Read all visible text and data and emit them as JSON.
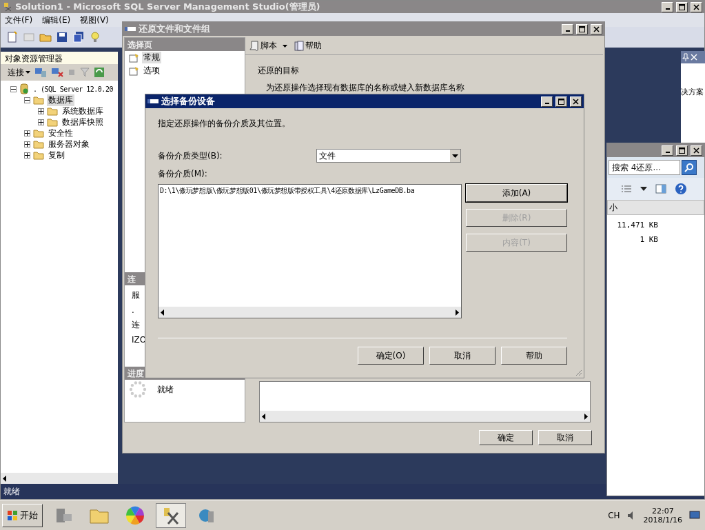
{
  "main_window": {
    "title": "Solution1 - Microsoft SQL Server Management Studio(管理员)",
    "menu": [
      "文件(F)",
      "编辑(E)",
      "视图(V)"
    ],
    "status": "就绪"
  },
  "object_explorer": {
    "title": "对象资源管理器",
    "connect": "连接",
    "tree": [
      {
        "label": ". (SQL Server 12.0.20",
        "kind": "server",
        "expanded": true,
        "selected": false,
        "children": [
          {
            "label": "数据库",
            "kind": "folder",
            "expanded": true,
            "selected": true,
            "children": [
              {
                "label": "系统数据库",
                "kind": "folder",
                "expanded": false,
                "selected": false
              },
              {
                "label": "数据库快照",
                "kind": "folder",
                "expanded": false,
                "selected": false
              }
            ]
          },
          {
            "label": "安全性",
            "kind": "folder",
            "expanded": false,
            "selected": false
          },
          {
            "label": "服务器对象",
            "kind": "folder",
            "expanded": false,
            "selected": false
          },
          {
            "label": "复制",
            "kind": "folder",
            "expanded": false,
            "selected": false
          }
        ]
      }
    ]
  },
  "solution_panel": {
    "text": "决方案"
  },
  "restore_dialog": {
    "title": "还原文件和文件组",
    "pages_header": "选择页",
    "pages": [
      {
        "label": "常规",
        "selected": true
      },
      {
        "label": "选项",
        "selected": false
      }
    ],
    "connection_header": "连",
    "connection_lines": [
      "服",
      ".",
      "连",
      "IZO"
    ],
    "progress_header": "进度",
    "progress_status": "就绪",
    "toolbar": [
      {
        "label": "脚本",
        "kind": "menu"
      },
      {
        "label": "帮助",
        "kind": "plain"
      }
    ],
    "section": "还原的目标",
    "hint": "为还原操作选择现有数据库的名称或键入新数据库名称",
    "buttons": [
      "确定",
      "取消"
    ]
  },
  "backup_dialog": {
    "title": "选择备份设备",
    "instruction": "指定还原操作的备份介质及其位置。",
    "media_type_label": "备份介质类型(B):",
    "media_type": "文件",
    "media_label": "备份介质(M):",
    "media": [
      "D:\\1\\傲玩梦想版\\傲玩梦想版01\\傲玩梦想版带授权工具\\4还原数据库\\LzGameDB.ba"
    ],
    "side_buttons": [
      {
        "label": "添加(A)",
        "disabled": false
      },
      {
        "label": "删除(R)",
        "disabled": true
      },
      {
        "label": "内容(T)",
        "disabled": true
      }
    ],
    "buttons": [
      "确定(O)",
      "取消",
      "帮助"
    ]
  },
  "explorer_window": {
    "search_placeholder": "搜索 4还原...",
    "column": "小",
    "sizes": [
      "11,471 KB",
      "1 KB"
    ]
  },
  "taskbar": {
    "start": "开始",
    "language": "CH",
    "time": "22:07",
    "date": "2018/1/16"
  }
}
